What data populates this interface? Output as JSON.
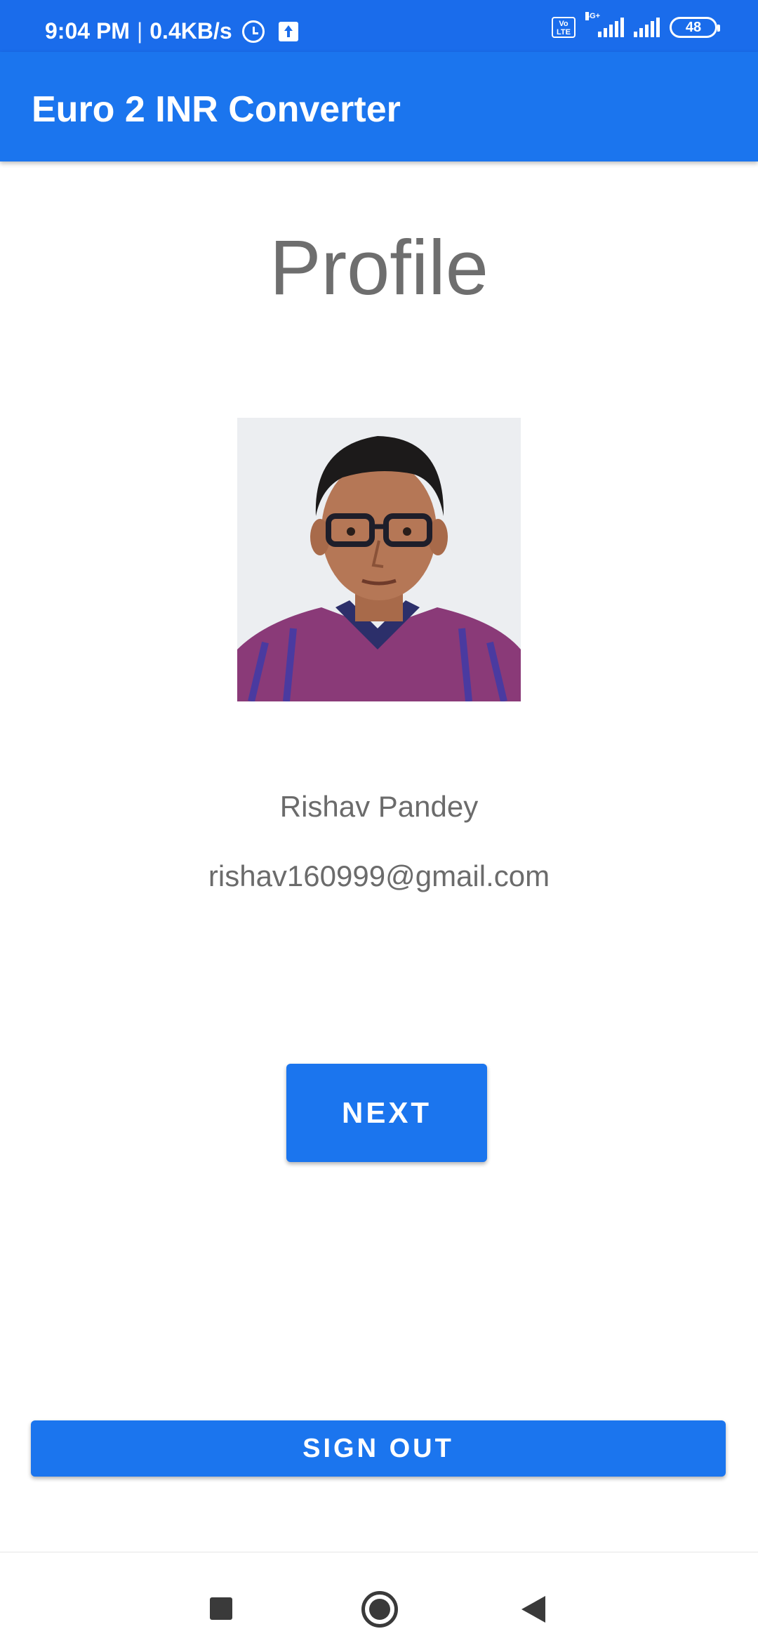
{
  "status_bar": {
    "time": "9:04 PM",
    "separator": "|",
    "net_speed": "0.4KB/s",
    "network_type": "4G+",
    "volte": "Vo LTE",
    "battery": "48"
  },
  "app_bar": {
    "title": "Euro 2 INR Converter"
  },
  "profile": {
    "heading": "Profile",
    "name": "Rishav Pandey",
    "email": "rishav160999@gmail.com"
  },
  "buttons": {
    "next_label": "NEXT",
    "signout_label": "SIGN OUT"
  },
  "colors": {
    "primary": "#1b75ee",
    "status_bar": "#1a6ceb",
    "text_gray": "#6b6b6b"
  },
  "icons": [
    "alarm-icon",
    "upload-icon",
    "volte-icon",
    "signal-icon",
    "battery-icon",
    "recents-icon",
    "home-icon",
    "back-icon"
  ]
}
